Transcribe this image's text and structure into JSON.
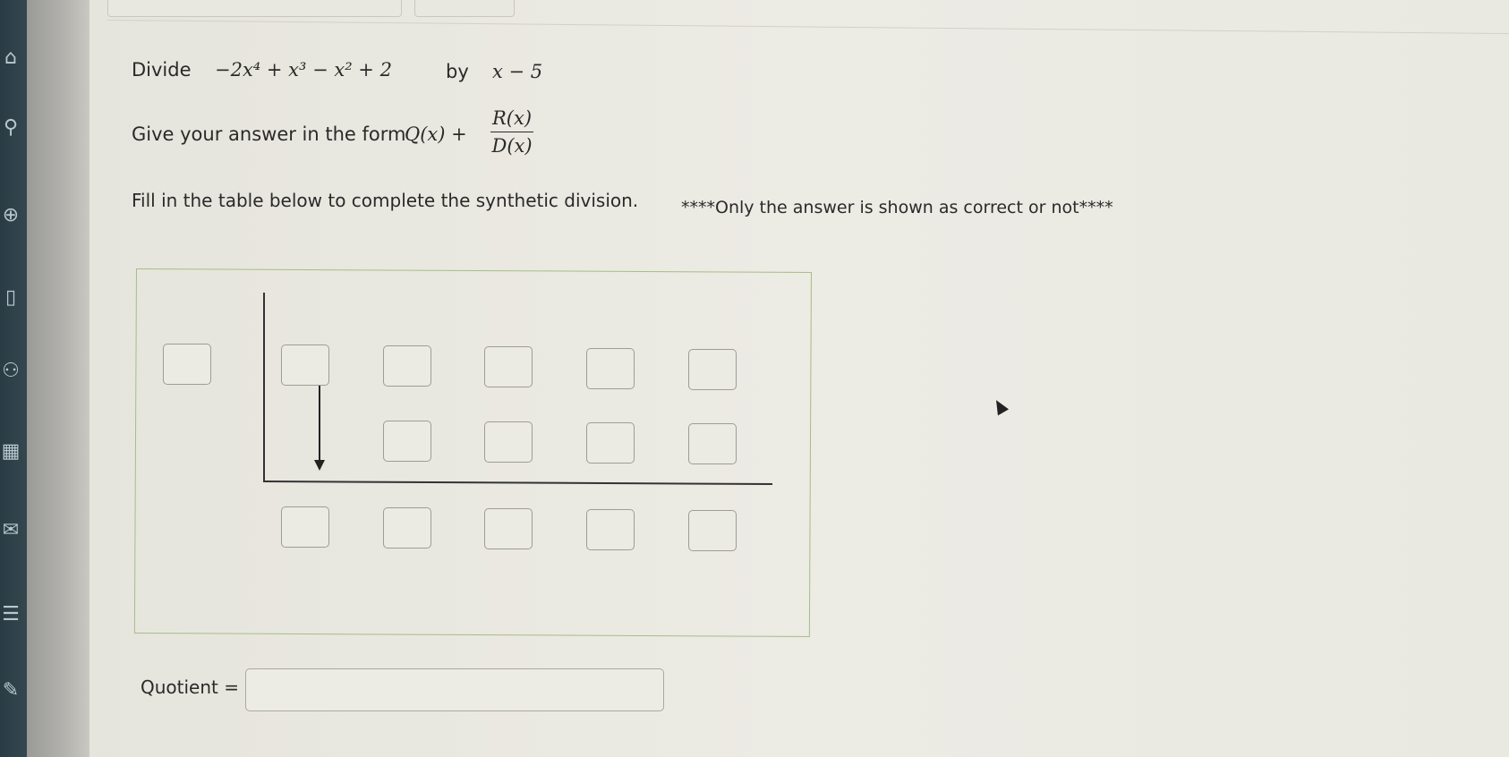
{
  "problem": {
    "divide_word": "Divide",
    "dividend": "−2x⁴ + x³ − x² + 2",
    "by_word": "by",
    "divisor": "x − 5"
  },
  "form": {
    "prefix": "Give your answer in the form",
    "q": "Q(x) +",
    "numerator": "R(x)",
    "denominator": "D(x)"
  },
  "instructions": "Fill in the table below to complete the synthetic division.",
  "note": "****Only the answer is shown as correct  or not****",
  "quotient_label": "Quotient ="
}
